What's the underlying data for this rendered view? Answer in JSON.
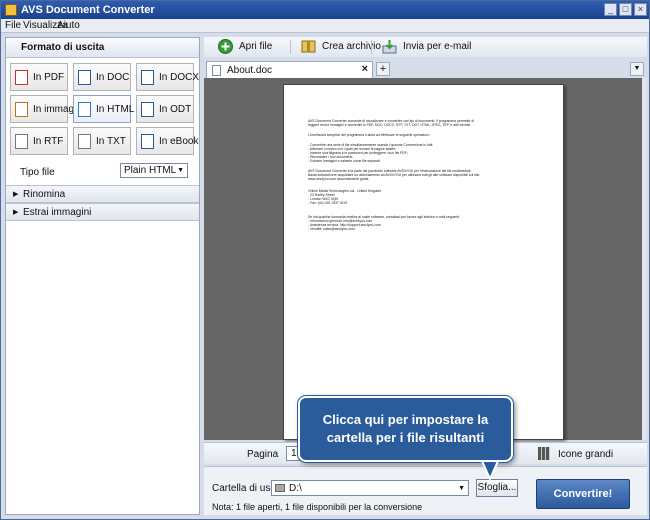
{
  "window": {
    "title": "AVS Document Converter"
  },
  "menu": [
    "File",
    "Visualizza",
    "Aiuto"
  ],
  "left_panel": {
    "header": "Formato di uscita",
    "formats": [
      "In PDF",
      "In DOC",
      "In DOCX",
      "In immagini",
      "In HTML",
      "In ODT",
      "In RTF",
      "In TXT",
      "In eBook"
    ],
    "selected_format": "In HTML",
    "tipo_file_label": "Tipo file",
    "tipo_file_value": "Plain HTML",
    "sections": [
      "Rinomina",
      "Estrai immagini"
    ]
  },
  "toolbar": {
    "open": "Apri file",
    "archive": "Crea archivio",
    "email": "Invia per e-mail"
  },
  "tabs": {
    "doc_tab": "About.doc",
    "add": "+"
  },
  "document": {
    "p1": "AVS Document Converter consente di visualizzare e convertire vari tipi di documenti. Il programma permette di\nleggere testi e immagini e convertirli in PDF, DOC, DOCX, RTF, TXT, ODT, HTML, JPEG, TIFF e altri formati.",
    "p2": "L'interfaccia semplice del programma ti aiuta ad effettuare le seguenti operazioni:",
    "p3": "- Convertire una serie di file simultaneamente usando l'opzione Conversione in lotti;\n- Allineare il motivo con i quali per trovare le pagine adatte;\n- Inserire una filigrana e le password per proteggere i tuoi file PDF;\n- Rinominare i tuoi documenti;\n- Estrarre immagini e salvarle come file separati.",
    "p4": "AVS Document Converter è la parte del pacchetto software AVS4YOU per l'elaborazione dei file multimediali.\nBasta sottoscrivere acquistare un abbonamento ad AVS4YOU per utilizzare tutti gli altri software disponibili sul sito\nwww.avs4you.com assolutamente gratis.",
    "p5": "Online Media Technologies Ltd., United Kingdom\n- 23 Harley Street\n- London W1G 9QN\n- Fax: (44) 020 7637 0419",
    "p6": "Se hai qualche domanda relativa ai nostri software, contattaci per favore agli indirizzi e-mail seguenti:\n- Informazioni generali: info@avs4you.com\n- Assistenza tecnica: http://support.avs4you.com\n- Vendite: sales@avs4you.com"
  },
  "nav": {
    "page_label": "Pagina",
    "page_value": "1",
    "view_label": "Icone grandi"
  },
  "bottom": {
    "output_label": "Cartella di uscita:",
    "output_value": "D:\\",
    "browse": "Sfoglia...",
    "convert": "Convertire!",
    "note": "Nota: 1 file aperti, 1 file disponibili per la conversione"
  },
  "callout": {
    "line1": "Clicca qui per impostare la",
    "line2": "cartella per i file risultanti"
  },
  "colors": {
    "accent": "#2a5c9c",
    "title_bar": "#2f5db0",
    "convert_button": "#2d5a9e"
  }
}
